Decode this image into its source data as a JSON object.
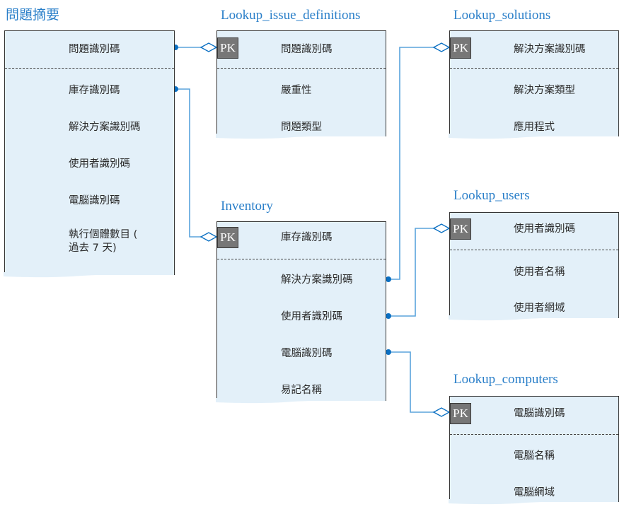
{
  "diagram": {
    "entities": [
      {
        "id": "issue_summary",
        "title": "問題摘要",
        "pk_field": {
          "label": "問題識別碼",
          "badge": ""
        },
        "fields": [
          "庫存識別碼",
          "解決方案識別碼",
          "使用者識別碼",
          "電腦識別碼",
          "執行個體數目 (\n過去 7 天)"
        ]
      },
      {
        "id": "lookup_issue_definitions",
        "title": "Lookup_issue_definitions",
        "pk_field": {
          "label": "問題識別碼",
          "badge": "PK"
        },
        "fields": [
          "嚴重性",
          "問題類型"
        ]
      },
      {
        "id": "lookup_solutions",
        "title": "Lookup_solutions",
        "pk_field": {
          "label": "解決方案識別碼",
          "badge": "PK"
        },
        "fields": [
          "解決方案類型",
          "應用程式"
        ]
      },
      {
        "id": "inventory",
        "title": "Inventory",
        "pk_field": {
          "label": "庫存識別碼",
          "badge": "PK"
        },
        "fields": [
          "解決方案識別碼",
          "使用者識別碼",
          "電腦識別碼",
          "易記名稱"
        ]
      },
      {
        "id": "lookup_users",
        "title": "Lookup_users",
        "pk_field": {
          "label": "使用者識別碼",
          "badge": "PK"
        },
        "fields": [
          "使用者名稱",
          "使用者網域"
        ]
      },
      {
        "id": "lookup_computers",
        "title": "Lookup_computers",
        "pk_field": {
          "label": "電腦識別碼",
          "badge": "PK"
        },
        "fields": [
          "電腦名稱",
          "電腦網域"
        ]
      }
    ],
    "relationships": [
      {
        "from": "問題摘要.問題識別碼",
        "to": "Lookup_issue_definitions.問題識別碼",
        "from_end": "dot",
        "to_end": "diamond"
      },
      {
        "from": "問題摘要.庫存識別碼",
        "to": "Inventory.庫存識別碼",
        "from_end": "dot",
        "to_end": "diamond"
      },
      {
        "from": "Inventory.解決方案識別碼",
        "to": "Lookup_solutions.解決方案識別碼",
        "from_end": "dot",
        "to_end": "diamond"
      },
      {
        "from": "Inventory.使用者識別碼",
        "to": "Lookup_users.使用者識別碼",
        "from_end": "dot",
        "to_end": "diamond"
      },
      {
        "from": "Inventory.電腦識別碼",
        "to": "Lookup_computers.電腦識別碼",
        "from_end": "dot",
        "to_end": "diamond"
      }
    ],
    "colors": {
      "title": "#2a7fc9",
      "box_fill": "#e3f0f9",
      "connector": "#5aa3dc",
      "dot": "#0a6fc2",
      "pk_badge": "#777777"
    }
  }
}
